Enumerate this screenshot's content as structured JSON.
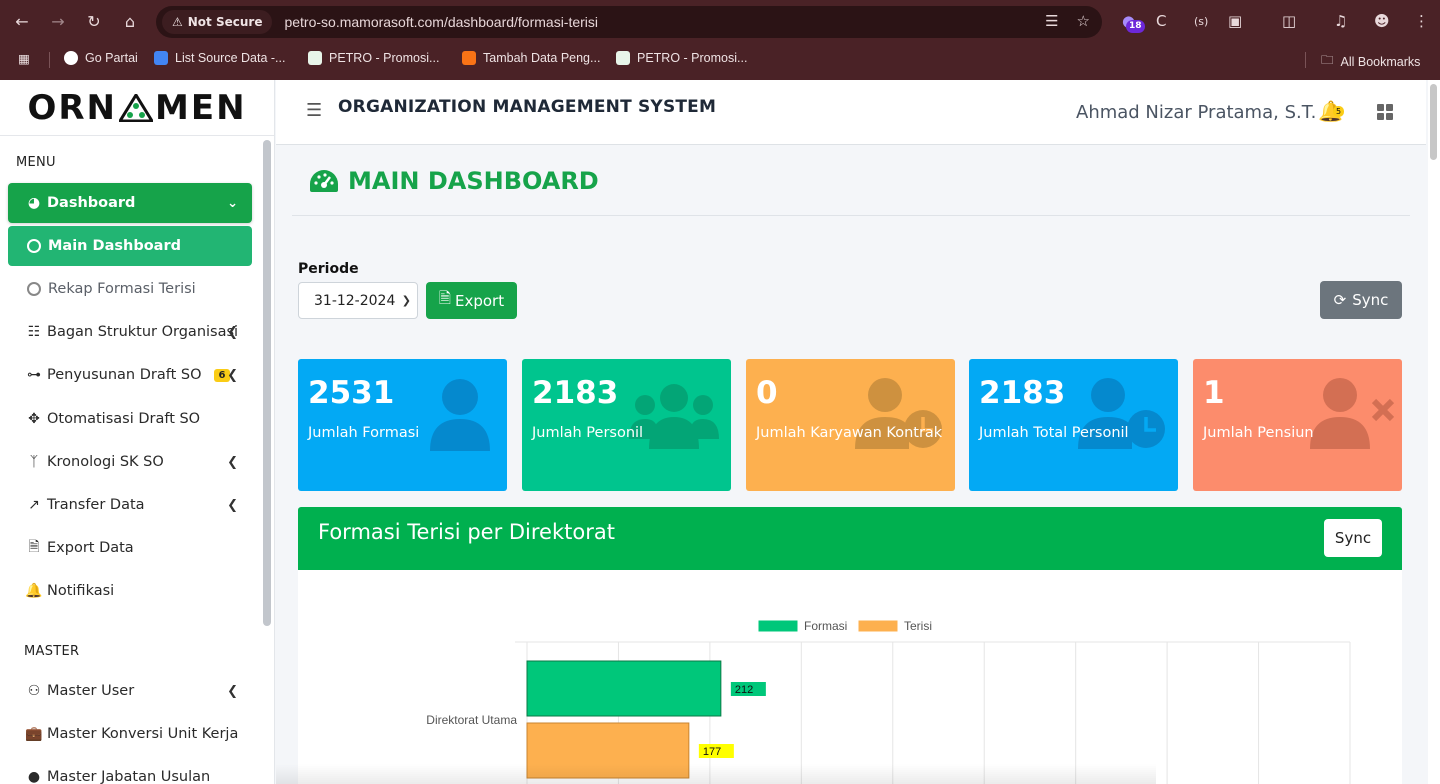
{
  "browser": {
    "security_label": "Not Secure",
    "url": "petro-so.mamorasoft.com/dashboard/formasi-terisi",
    "extension_badge": "18",
    "bookmarks": [
      "Go Partai",
      "List Source Data -...",
      "PETRO - Promosi...",
      "Tambah Data Peng...",
      "PETRO - Promosi..."
    ],
    "all_bookmarks": "All Bookmarks"
  },
  "sidebar": {
    "logo_left": "ORN",
    "logo_right": "MEN",
    "menu_label": "MENU",
    "master_label": "MASTER",
    "items": [
      {
        "label": "Dashboard"
      },
      {
        "label": "Main Dashboard"
      },
      {
        "label": "Rekap Formasi Terisi"
      },
      {
        "label": "Bagan Struktur Organisasi"
      },
      {
        "label": "Penyusunan Draft SO",
        "badge": "6"
      },
      {
        "label": "Otomatisasi Draft SO"
      },
      {
        "label": "Kronologi SK SO"
      },
      {
        "label": "Transfer Data"
      },
      {
        "label": "Export Data"
      },
      {
        "label": "Notifikasi"
      }
    ],
    "master_items": [
      {
        "label": "Master User"
      },
      {
        "label": "Master Konversi Unit Kerja"
      },
      {
        "label": "Master Jabatan Usulan"
      }
    ]
  },
  "header": {
    "title": "ORGANIZATION MANAGEMENT SYSTEM",
    "user": "Ahmad Nizar Pratama, S.T.",
    "notif_count": "5"
  },
  "page": {
    "title": "MAIN DASHBOARD",
    "periode_label": "Periode",
    "periode_value": "31-12-2024",
    "export_label": "Export",
    "sync_label": "Sync"
  },
  "cards": [
    {
      "value": "2531",
      "label": "Jumlah Formasi",
      "color": "#03a9f4"
    },
    {
      "value": "2183",
      "label": "Jumlah Personil",
      "color": "#00c58e"
    },
    {
      "value": "0",
      "label": "Jumlah Karyawan Kontrak",
      "color": "#fdb04f"
    },
    {
      "value": "2183",
      "label": "Jumlah Total Personil",
      "color": "#03a9f4"
    },
    {
      "value": "1",
      "label": "Jumlah Pensiun",
      "color": "#fc8c6c"
    }
  ],
  "panel": {
    "title": "Formasi Terisi per Direktorat",
    "sync_label": "Sync"
  },
  "colors": {
    "primary_green": "#16a34a",
    "formasi": "#00c77a",
    "terisi": "#fdb04f"
  },
  "chart_data": {
    "type": "bar",
    "orientation": "horizontal",
    "title": "",
    "legend_position": "top",
    "categories": [
      "Direktorat Utama"
    ],
    "series": [
      {
        "name": "Formasi",
        "values": [
          212
        ]
      },
      {
        "name": "Terisi",
        "values": [
          177
        ]
      }
    ],
    "xlim": [
      0,
      900
    ],
    "grid": true
  }
}
